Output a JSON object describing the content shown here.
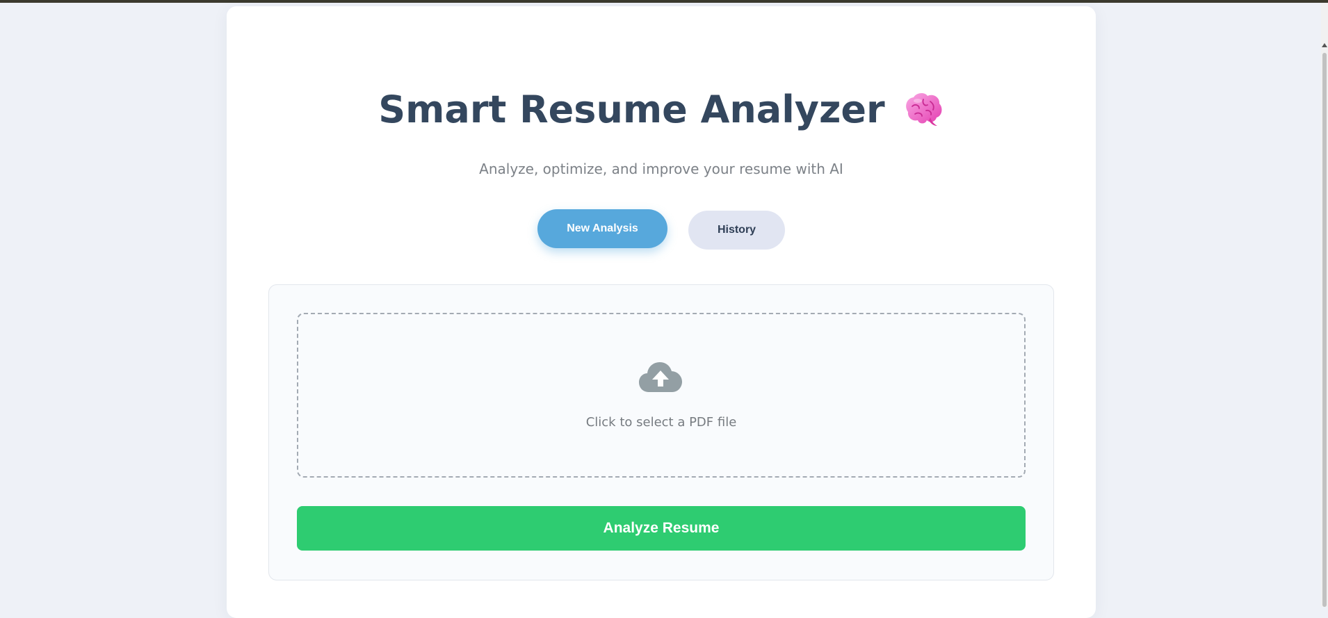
{
  "header": {
    "title": "Smart Resume Analyzer",
    "title_icon": "brain-icon",
    "subtitle": "Analyze, optimize, and improve your resume with AI"
  },
  "tabs": {
    "new_analysis": "New Analysis",
    "history": "History"
  },
  "upload": {
    "icon": "cloud-upload-icon",
    "label": "Click to select a PDF file"
  },
  "actions": {
    "analyze_label": "Analyze Resume"
  },
  "colors": {
    "title": "#34475e",
    "tab_active": "#57a8dc",
    "tab_inactive": "#e1e5f2",
    "analyze_button": "#2ecc71",
    "page_background": "#eef1f7"
  }
}
